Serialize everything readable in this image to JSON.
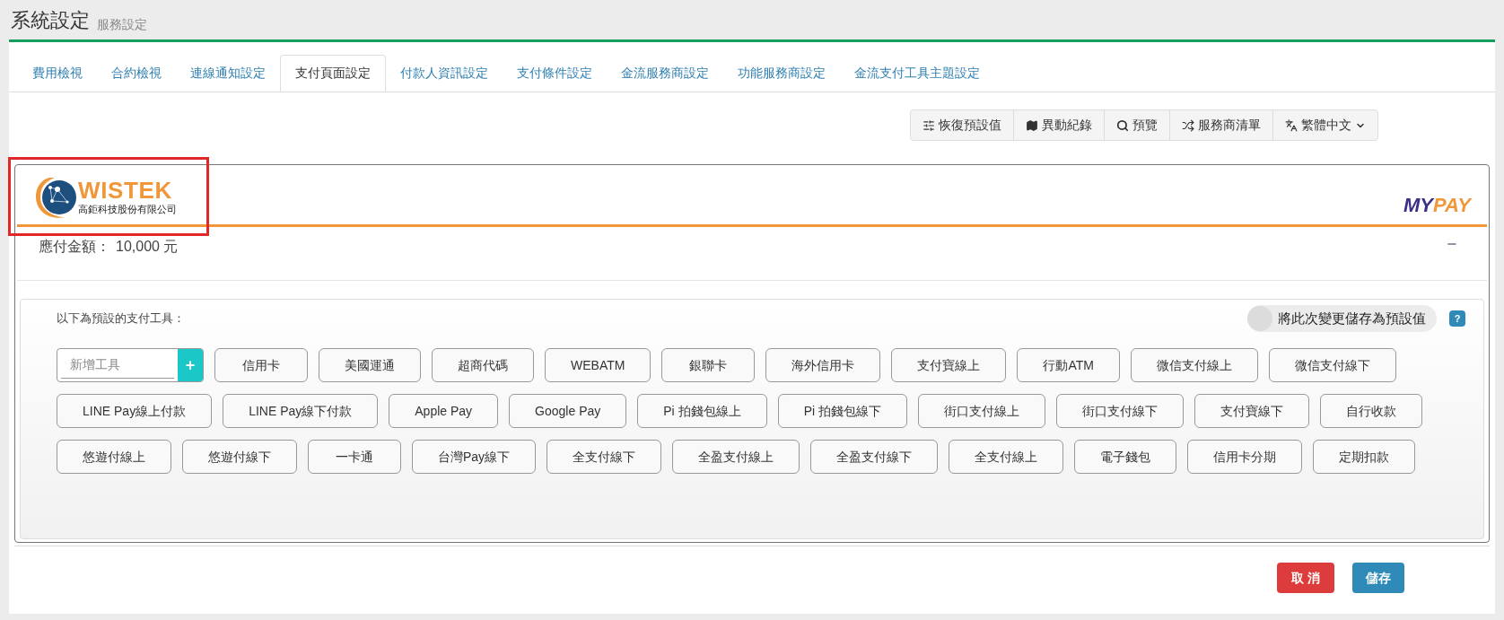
{
  "header": {
    "title": "系統設定",
    "subtitle": "服務設定"
  },
  "tabs": [
    {
      "label": "費用檢視",
      "selected": false
    },
    {
      "label": "合約檢視",
      "selected": false
    },
    {
      "label": "連線通知設定",
      "selected": false
    },
    {
      "label": "支付頁面設定",
      "selected": true
    },
    {
      "label": "付款人資訊設定",
      "selected": false
    },
    {
      "label": "支付條件設定",
      "selected": false
    },
    {
      "label": "金流服務商設定",
      "selected": false
    },
    {
      "label": "功能服務商設定",
      "selected": false
    },
    {
      "label": "金流支付工具主題設定",
      "selected": false
    }
  ],
  "toolbar": [
    {
      "kind": "sliders",
      "label": "恢復預設值"
    },
    {
      "kind": "map",
      "label": "異動紀錄"
    },
    {
      "kind": "search",
      "label": "預覽"
    },
    {
      "kind": "shuffle",
      "label": "服務商清單"
    },
    {
      "kind": "language",
      "label": "繁體中文"
    }
  ],
  "preview": {
    "company_logo": {
      "name": "WISTEK",
      "subtitle": "高鉅科技股份有限公司"
    },
    "brand_logo": {
      "part_1": "MY",
      "part_2": "PAY"
    },
    "amount": {
      "label": "應付金額：",
      "value": "10,000 元"
    },
    "collapse": "−"
  },
  "tools": {
    "caption": "以下為預設的支付工具：",
    "save_as_default": {
      "label": "將此次變更儲存為預設值",
      "on": false
    },
    "help": "?",
    "add_field": {
      "placeholder": "新增工具",
      "button": "+"
    },
    "items": [
      "信用卡",
      "美國運通",
      "超商代碼",
      "WEBATM",
      "銀聯卡",
      "海外信用卡",
      "支付寶線上",
      "行動ATM",
      "微信支付線上",
      "微信支付線下",
      "LINE Pay線上付款",
      "LINE Pay線下付款",
      "Apple Pay",
      "Google Pay",
      "Pi 拍錢包線上",
      "Pi 拍錢包線下",
      "街口支付線上",
      "街口支付線下",
      "支付寶線下",
      "自行收款",
      "悠遊付線上",
      "悠遊付線下",
      "一卡通",
      "台灣Pay線下",
      "全支付線下",
      "全盈支付線上",
      "全盈支付線下",
      "全支付線上",
      "電子錢包",
      "信用卡分期",
      "定期扣款"
    ]
  },
  "footer": {
    "cancel": "取 消",
    "save": "儲存"
  }
}
